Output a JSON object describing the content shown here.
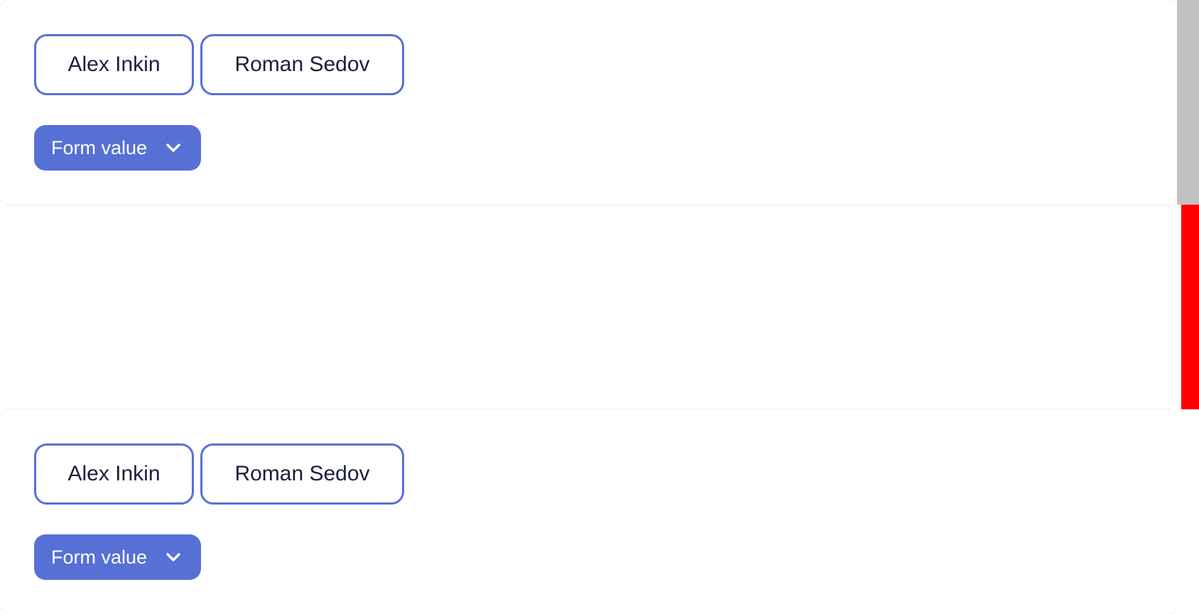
{
  "colors": {
    "accent": "#5670d5",
    "chip_text": "#1b1f3b",
    "scroll_grey": "#c2c2c2",
    "scroll_red": "#ff0000"
  },
  "sections": [
    {
      "chips": [
        {
          "label": "Alex Inkin"
        },
        {
          "label": "Roman Sedov"
        }
      ],
      "dropdown": {
        "label": "Form value",
        "icon": "chevron-down-icon"
      }
    },
    {
      "chips": [
        {
          "label": "Alex Inkin"
        },
        {
          "label": "Roman Sedov"
        }
      ],
      "dropdown": {
        "label": "Form value",
        "icon": "chevron-down-icon"
      }
    }
  ]
}
